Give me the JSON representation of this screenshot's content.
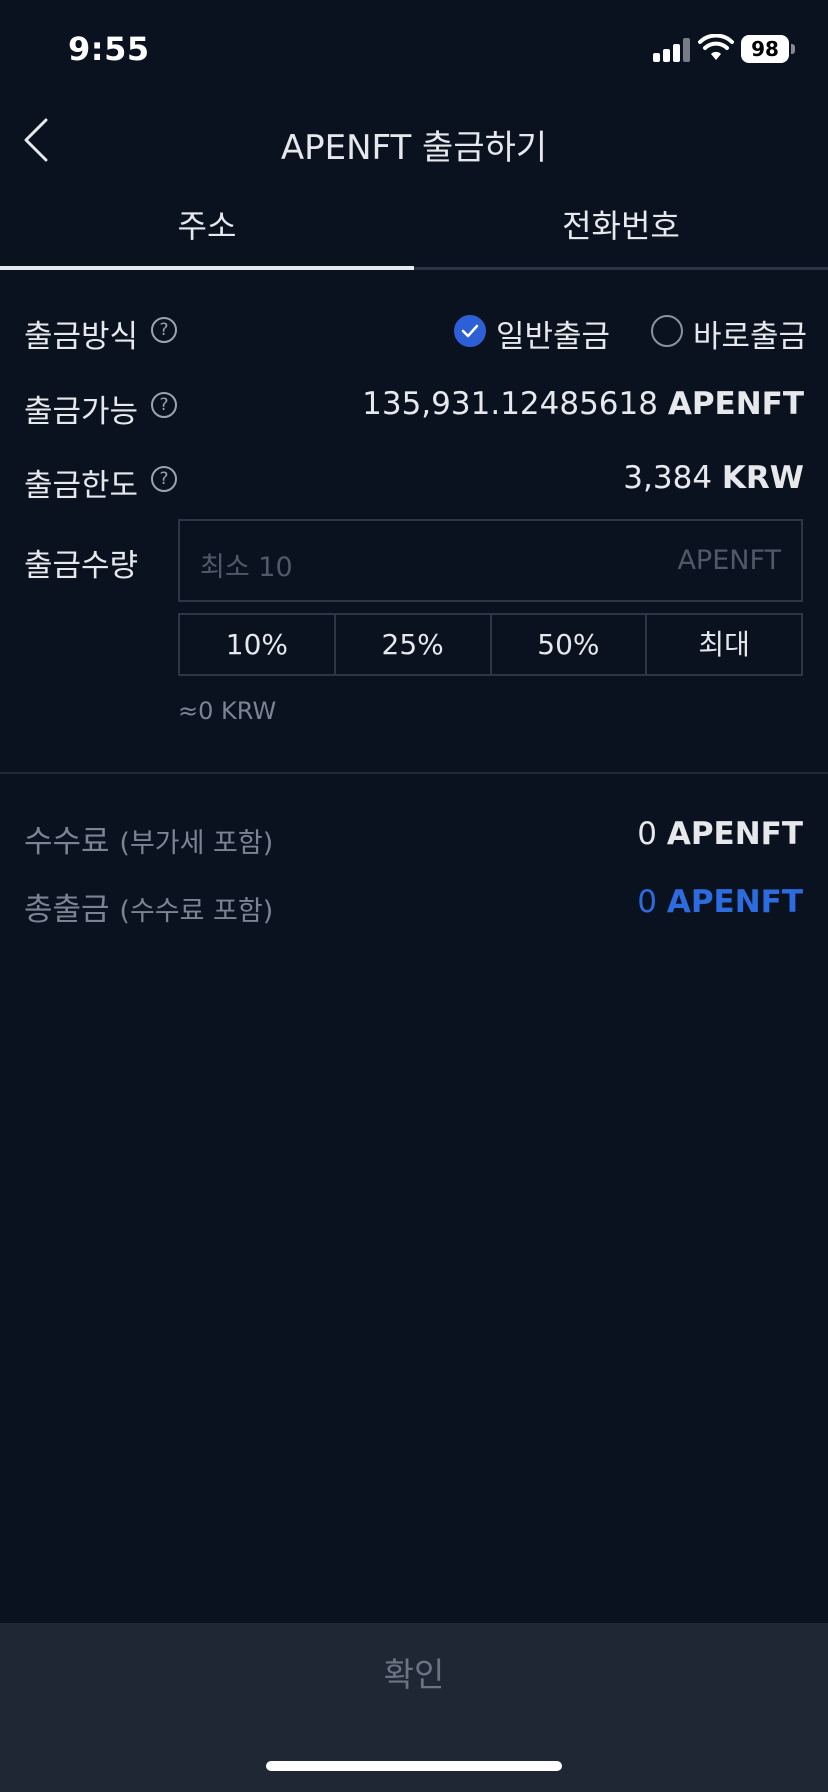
{
  "status_bar": {
    "time": "9:55",
    "battery": "98"
  },
  "header": {
    "title": "APENFT 출금하기"
  },
  "tabs": [
    {
      "label": "주소",
      "active": true
    },
    {
      "label": "전화번호",
      "active": false
    }
  ],
  "withdraw_method": {
    "label": "출금방식",
    "options": [
      {
        "label": "일반출금",
        "checked": true
      },
      {
        "label": "바로출금",
        "checked": false
      }
    ]
  },
  "available": {
    "label": "출금가능",
    "amount": "135,931.12485618",
    "unit": "APENFT"
  },
  "limit": {
    "label": "출금한도",
    "amount": "3,384",
    "unit": "KRW"
  },
  "amount": {
    "label": "출금수량",
    "placeholder": "최소 10",
    "unit": "APENFT",
    "percent_buttons": [
      "10%",
      "25%",
      "50%",
      "최대"
    ],
    "krw_equivalent": "≈0 KRW"
  },
  "fee": {
    "label": "수수료",
    "note": "(부가세 포함)",
    "amount": "0",
    "unit": "APENFT"
  },
  "total": {
    "label": "총출금",
    "note": "(수수료 포함)",
    "amount": "0",
    "unit": "APENFT"
  },
  "confirm": {
    "label": "확인"
  },
  "colors": {
    "background": "#0a1220",
    "accent": "#2d6ce0",
    "check": "#2d5fd6",
    "button": "#1f2735"
  },
  "icons": {
    "back": "chevron-left-icon",
    "help": "question-circle-icon",
    "check": "check-icon"
  }
}
